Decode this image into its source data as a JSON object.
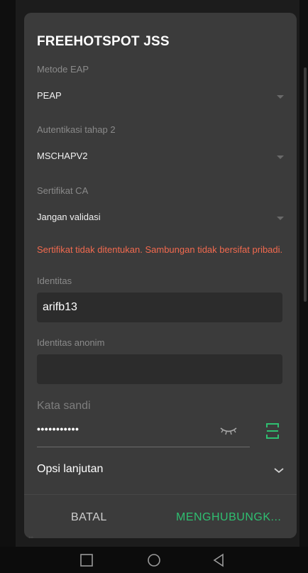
{
  "dialog": {
    "title": "FREEHOTSPOT JSS",
    "eap_method": {
      "label": "Metode EAP",
      "value": "PEAP"
    },
    "phase2_auth": {
      "label": "Autentikasi tahap 2",
      "value": "MSCHAPV2"
    },
    "ca_certificate": {
      "label": "Sertifikat CA",
      "value": "Jangan validasi"
    },
    "warning": "Sertifikat tidak ditentukan. Sambungan tidak bersifat pribadi.",
    "identity": {
      "label": "Identitas",
      "value": "arifb13"
    },
    "anonymous_identity": {
      "label": "Identitas anonim",
      "value": ""
    },
    "password": {
      "label": "Kata sandi",
      "masked_value": "•••••••••••"
    },
    "advanced_options": {
      "label": "Opsi lanjutan"
    },
    "buttons": {
      "cancel": "BATAL",
      "connect": "MENGHUBUNGK..."
    }
  },
  "colors": {
    "dialog_bg": "#3b3b3b",
    "accent_green": "#2fbf71",
    "warning_red": "#f26a4f"
  },
  "icons": {
    "password_toggle": "eye-closed-icon",
    "qr_scan": "barcode-scan-icon",
    "advanced_expand": "chevron-down-icon",
    "nav": [
      "recent-apps-icon",
      "home-icon",
      "back-icon"
    ]
  }
}
